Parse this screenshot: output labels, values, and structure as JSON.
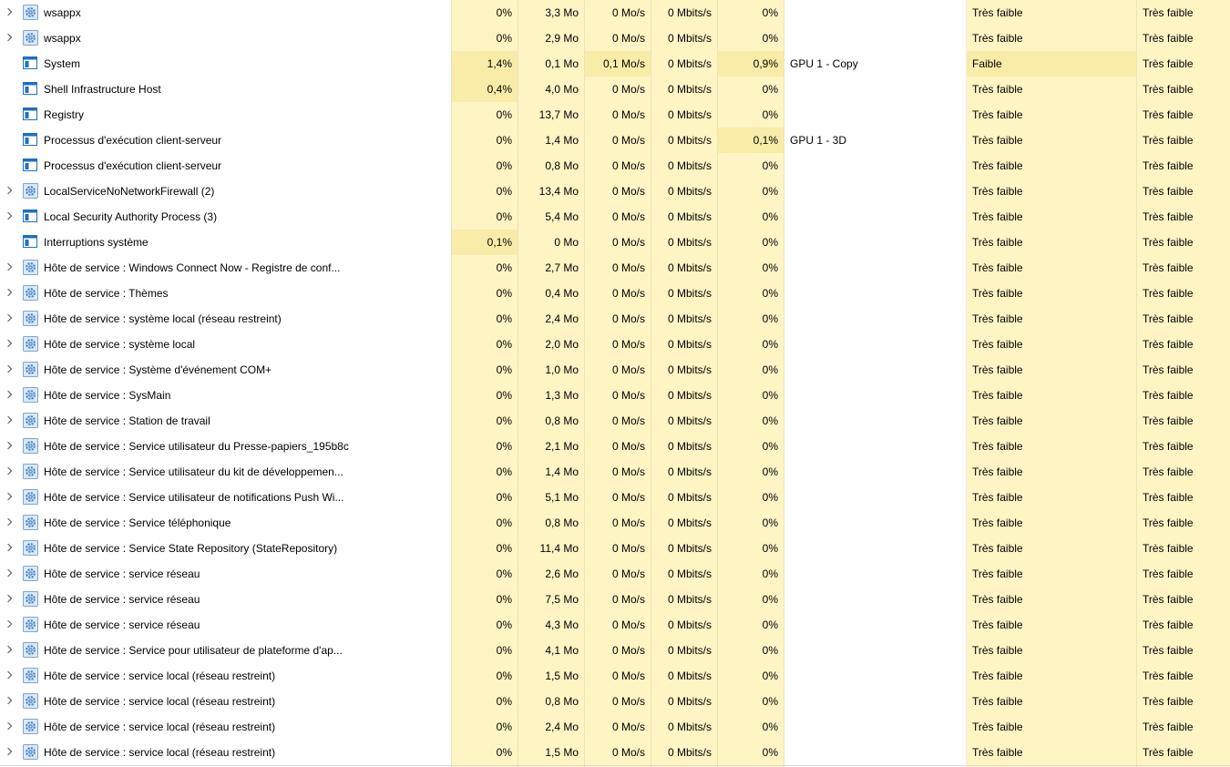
{
  "colors": {
    "heat_low": "#fff4c4",
    "heat_mid": "#f9eca8",
    "icon_blue": "#1e6fbf",
    "gear_blue": "#4a89c8"
  },
  "processes": [
    {
      "name": "wsappx",
      "expandable": true,
      "icon": "gear-icon",
      "cpu": "0%",
      "mem": "3,3 Mo",
      "disk": "0 Mo/s",
      "net": "0 Mbits/s",
      "gpu": "0%",
      "engine": "",
      "power": "Très faible",
      "power_trend": "Très faible",
      "hl": {}
    },
    {
      "name": "wsappx",
      "expandable": true,
      "icon": "gear-icon",
      "cpu": "0%",
      "mem": "2,9 Mo",
      "disk": "0 Mo/s",
      "net": "0 Mbits/s",
      "gpu": "0%",
      "engine": "",
      "power": "Très faible",
      "power_trend": "Très faible",
      "hl": {}
    },
    {
      "name": "System",
      "expandable": false,
      "icon": "window-icon",
      "cpu": "1,4%",
      "mem": "0,1 Mo",
      "disk": "0,1 Mo/s",
      "net": "0 Mbits/s",
      "gpu": "0,9%",
      "engine": "GPU 1 - Copy",
      "power": "Faible",
      "power_trend": "Très faible",
      "hl": {
        "cpu": true,
        "disk": true,
        "gpu": true,
        "power": true
      }
    },
    {
      "name": "Shell Infrastructure Host",
      "expandable": false,
      "icon": "window-icon",
      "cpu": "0,4%",
      "mem": "4,0 Mo",
      "disk": "0 Mo/s",
      "net": "0 Mbits/s",
      "gpu": "0%",
      "engine": "",
      "power": "Très faible",
      "power_trend": "Très faible",
      "hl": {
        "cpu": true
      }
    },
    {
      "name": "Registry",
      "expandable": false,
      "icon": "window-icon",
      "cpu": "0%",
      "mem": "13,7 Mo",
      "disk": "0 Mo/s",
      "net": "0 Mbits/s",
      "gpu": "0%",
      "engine": "",
      "power": "Très faible",
      "power_trend": "Très faible",
      "hl": {}
    },
    {
      "name": "Processus d'exécution client-serveur",
      "expandable": false,
      "icon": "window-icon",
      "cpu": "0%",
      "mem": "1,4 Mo",
      "disk": "0 Mo/s",
      "net": "0 Mbits/s",
      "gpu": "0,1%",
      "engine": "GPU 1 - 3D",
      "power": "Très faible",
      "power_trend": "Très faible",
      "hl": {
        "gpu": true
      }
    },
    {
      "name": "Processus d'exécution client-serveur",
      "expandable": false,
      "icon": "window-icon",
      "cpu": "0%",
      "mem": "0,8 Mo",
      "disk": "0 Mo/s",
      "net": "0 Mbits/s",
      "gpu": "0%",
      "engine": "",
      "power": "Très faible",
      "power_trend": "Très faible",
      "hl": {}
    },
    {
      "name": "LocalServiceNoNetworkFirewall (2)",
      "expandable": true,
      "icon": "gear-icon",
      "cpu": "0%",
      "mem": "13,4 Mo",
      "disk": "0 Mo/s",
      "net": "0 Mbits/s",
      "gpu": "0%",
      "engine": "",
      "power": "Très faible",
      "power_trend": "Très faible",
      "hl": {}
    },
    {
      "name": "Local Security Authority Process (3)",
      "expandable": true,
      "icon": "window-icon",
      "cpu": "0%",
      "mem": "5,4 Mo",
      "disk": "0 Mo/s",
      "net": "0 Mbits/s",
      "gpu": "0%",
      "engine": "",
      "power": "Très faible",
      "power_trend": "Très faible",
      "hl": {}
    },
    {
      "name": "Interruptions système",
      "expandable": false,
      "icon": "window-icon",
      "cpu": "0,1%",
      "mem": "0 Mo",
      "disk": "0 Mo/s",
      "net": "0 Mbits/s",
      "gpu": "0%",
      "engine": "",
      "power": "Très faible",
      "power_trend": "Très faible",
      "hl": {
        "cpu": true
      }
    },
    {
      "name": "Hôte de service : Windows Connect Now - Registre de conf...",
      "expandable": true,
      "icon": "gear-icon",
      "cpu": "0%",
      "mem": "2,7 Mo",
      "disk": "0 Mo/s",
      "net": "0 Mbits/s",
      "gpu": "0%",
      "engine": "",
      "power": "Très faible",
      "power_trend": "Très faible",
      "hl": {}
    },
    {
      "name": "Hôte de service : Thèmes",
      "expandable": true,
      "icon": "gear-icon",
      "cpu": "0%",
      "mem": "0,4 Mo",
      "disk": "0 Mo/s",
      "net": "0 Mbits/s",
      "gpu": "0%",
      "engine": "",
      "power": "Très faible",
      "power_trend": "Très faible",
      "hl": {}
    },
    {
      "name": "Hôte de service : système local (réseau restreint)",
      "expandable": true,
      "icon": "gear-icon",
      "cpu": "0%",
      "mem": "2,4 Mo",
      "disk": "0 Mo/s",
      "net": "0 Mbits/s",
      "gpu": "0%",
      "engine": "",
      "power": "Très faible",
      "power_trend": "Très faible",
      "hl": {}
    },
    {
      "name": "Hôte de service : système local",
      "expandable": true,
      "icon": "gear-icon",
      "cpu": "0%",
      "mem": "2,0 Mo",
      "disk": "0 Mo/s",
      "net": "0 Mbits/s",
      "gpu": "0%",
      "engine": "",
      "power": "Très faible",
      "power_trend": "Très faible",
      "hl": {}
    },
    {
      "name": "Hôte de service : Système d'événement COM+",
      "expandable": true,
      "icon": "gear-icon",
      "cpu": "0%",
      "mem": "1,0 Mo",
      "disk": "0 Mo/s",
      "net": "0 Mbits/s",
      "gpu": "0%",
      "engine": "",
      "power": "Très faible",
      "power_trend": "Très faible",
      "hl": {}
    },
    {
      "name": "Hôte de service : SysMain",
      "expandable": true,
      "icon": "gear-icon",
      "cpu": "0%",
      "mem": "1,3 Mo",
      "disk": "0 Mo/s",
      "net": "0 Mbits/s",
      "gpu": "0%",
      "engine": "",
      "power": "Très faible",
      "power_trend": "Très faible",
      "hl": {}
    },
    {
      "name": "Hôte de service : Station de travail",
      "expandable": true,
      "icon": "gear-icon",
      "cpu": "0%",
      "mem": "0,8 Mo",
      "disk": "0 Mo/s",
      "net": "0 Mbits/s",
      "gpu": "0%",
      "engine": "",
      "power": "Très faible",
      "power_trend": "Très faible",
      "hl": {}
    },
    {
      "name": "Hôte de service : Service utilisateur du Presse-papiers_195b8c",
      "expandable": true,
      "icon": "gear-icon",
      "cpu": "0%",
      "mem": "2,1 Mo",
      "disk": "0 Mo/s",
      "net": "0 Mbits/s",
      "gpu": "0%",
      "engine": "",
      "power": "Très faible",
      "power_trend": "Très faible",
      "hl": {}
    },
    {
      "name": "Hôte de service : Service utilisateur du kit de développemen...",
      "expandable": true,
      "icon": "gear-icon",
      "cpu": "0%",
      "mem": "1,4 Mo",
      "disk": "0 Mo/s",
      "net": "0 Mbits/s",
      "gpu": "0%",
      "engine": "",
      "power": "Très faible",
      "power_trend": "Très faible",
      "hl": {}
    },
    {
      "name": "Hôte de service : Service utilisateur de notifications Push Wi...",
      "expandable": true,
      "icon": "gear-icon",
      "cpu": "0%",
      "mem": "5,1 Mo",
      "disk": "0 Mo/s",
      "net": "0 Mbits/s",
      "gpu": "0%",
      "engine": "",
      "power": "Très faible",
      "power_trend": "Très faible",
      "hl": {}
    },
    {
      "name": "Hôte de service : Service téléphonique",
      "expandable": true,
      "icon": "gear-icon",
      "cpu": "0%",
      "mem": "0,8 Mo",
      "disk": "0 Mo/s",
      "net": "0 Mbits/s",
      "gpu": "0%",
      "engine": "",
      "power": "Très faible",
      "power_trend": "Très faible",
      "hl": {}
    },
    {
      "name": "Hôte de service : Service State Repository (StateRepository)",
      "expandable": true,
      "icon": "gear-icon",
      "cpu": "0%",
      "mem": "11,4 Mo",
      "disk": "0 Mo/s",
      "net": "0 Mbits/s",
      "gpu": "0%",
      "engine": "",
      "power": "Très faible",
      "power_trend": "Très faible",
      "hl": {}
    },
    {
      "name": "Hôte de service : service réseau",
      "expandable": true,
      "icon": "gear-icon",
      "cpu": "0%",
      "mem": "2,6 Mo",
      "disk": "0 Mo/s",
      "net": "0 Mbits/s",
      "gpu": "0%",
      "engine": "",
      "power": "Très faible",
      "power_trend": "Très faible",
      "hl": {}
    },
    {
      "name": "Hôte de service : service réseau",
      "expandable": true,
      "icon": "gear-icon",
      "cpu": "0%",
      "mem": "7,5 Mo",
      "disk": "0 Mo/s",
      "net": "0 Mbits/s",
      "gpu": "0%",
      "engine": "",
      "power": "Très faible",
      "power_trend": "Très faible",
      "hl": {}
    },
    {
      "name": "Hôte de service : service réseau",
      "expandable": true,
      "icon": "gear-icon",
      "cpu": "0%",
      "mem": "4,3 Mo",
      "disk": "0 Mo/s",
      "net": "0 Mbits/s",
      "gpu": "0%",
      "engine": "",
      "power": "Très faible",
      "power_trend": "Très faible",
      "hl": {}
    },
    {
      "name": "Hôte de service : Service pour utilisateur de plateforme d'ap...",
      "expandable": true,
      "icon": "gear-icon",
      "cpu": "0%",
      "mem": "4,1 Mo",
      "disk": "0 Mo/s",
      "net": "0 Mbits/s",
      "gpu": "0%",
      "engine": "",
      "power": "Très faible",
      "power_trend": "Très faible",
      "hl": {}
    },
    {
      "name": "Hôte de service : service local (réseau restreint)",
      "expandable": true,
      "icon": "gear-icon",
      "cpu": "0%",
      "mem": "1,5 Mo",
      "disk": "0 Mo/s",
      "net": "0 Mbits/s",
      "gpu": "0%",
      "engine": "",
      "power": "Très faible",
      "power_trend": "Très faible",
      "hl": {}
    },
    {
      "name": "Hôte de service : service local (réseau restreint)",
      "expandable": true,
      "icon": "gear-icon",
      "cpu": "0%",
      "mem": "0,8 Mo",
      "disk": "0 Mo/s",
      "net": "0 Mbits/s",
      "gpu": "0%",
      "engine": "",
      "power": "Très faible",
      "power_trend": "Très faible",
      "hl": {}
    },
    {
      "name": "Hôte de service : service local (réseau restreint)",
      "expandable": true,
      "icon": "gear-icon",
      "cpu": "0%",
      "mem": "2,4 Mo",
      "disk": "0 Mo/s",
      "net": "0 Mbits/s",
      "gpu": "0%",
      "engine": "",
      "power": "Très faible",
      "power_trend": "Très faible",
      "hl": {}
    },
    {
      "name": "Hôte de service : service local (réseau restreint)",
      "expandable": true,
      "icon": "gear-icon",
      "cpu": "0%",
      "mem": "1,5 Mo",
      "disk": "0 Mo/s",
      "net": "0 Mbits/s",
      "gpu": "0%",
      "engine": "",
      "power": "Très faible",
      "power_trend": "Très faible",
      "hl": {}
    }
  ]
}
